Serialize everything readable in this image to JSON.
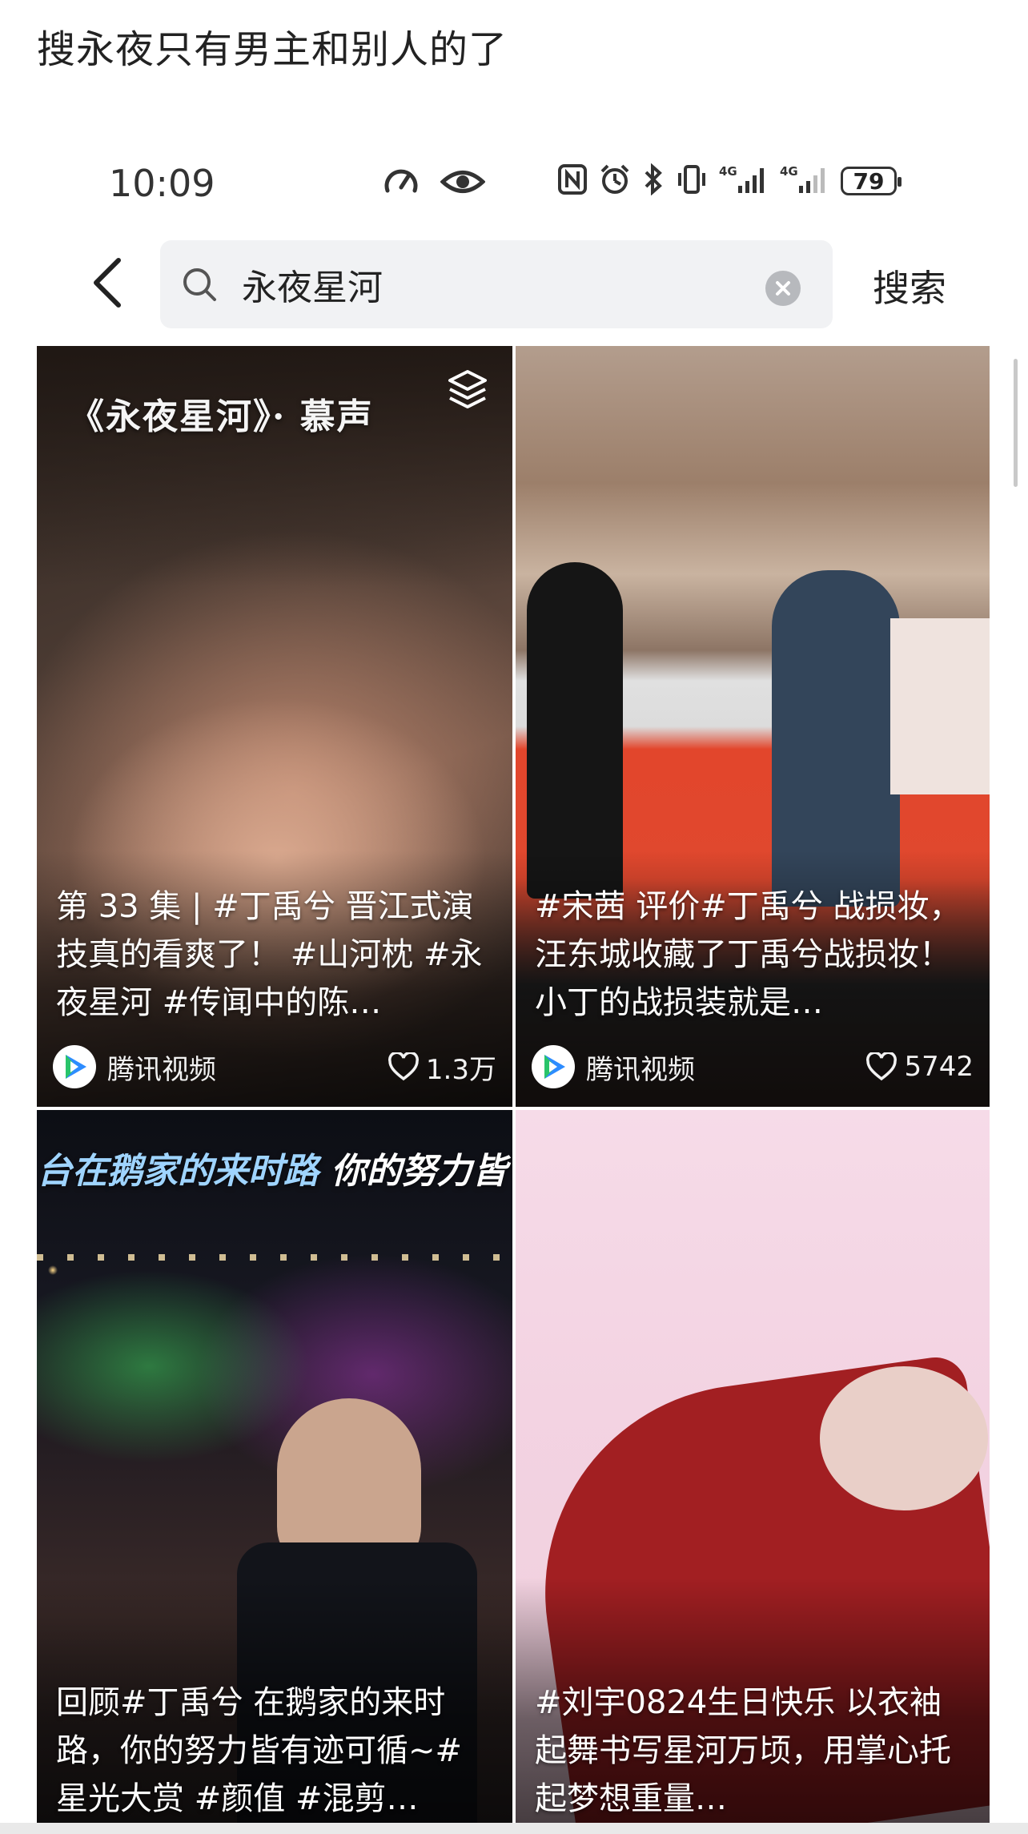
{
  "caption": "搜永夜只有男主和别人的了",
  "status_bar": {
    "time": "10:09",
    "battery": "79",
    "icons": [
      "speed-icon",
      "eye-icon",
      "nfc-icon",
      "alarm-icon",
      "bluetooth-icon",
      "vibrate-icon",
      "signal-4g-icon",
      "signal-4g-icon"
    ]
  },
  "search": {
    "back_icon": "chevron-left-icon",
    "query": "永夜星河",
    "submit_label": "搜索"
  },
  "results": [
    {
      "overlay_title": "《永夜星河》· 慕声",
      "title": "第 33 集 | #丁禹兮 晋江式演技真的看爽了！ #山河枕 #永夜星河 #传闻中的陈…",
      "source": "腾讯视频",
      "likes": "1.3万",
      "has_collection_icon": true
    },
    {
      "title": "#宋茜 评价#丁禹兮 战损妆，汪东城收藏了丁禹兮战损妆！小丁的战损装就是…",
      "source": "腾讯视频",
      "likes": "5742"
    },
    {
      "banner": "台在鹅家的来时路",
      "banner_tail": "你的努力皆",
      "title": "回顾#丁禹兮 在鹅家的来时路，你的努力皆有迹可循~#星光大赏 #颜值 #混剪…"
    },
    {
      "title": "#刘宇0824生日快乐 以衣袖起舞书写星河万顷，用掌心托起梦想重量…"
    }
  ],
  "colors": {
    "search_box_bg": "#f1f2f4",
    "tencent_blue": "#2d8cff",
    "tencent_green": "#29c46a",
    "tencent_orange": "#ffa21a"
  }
}
